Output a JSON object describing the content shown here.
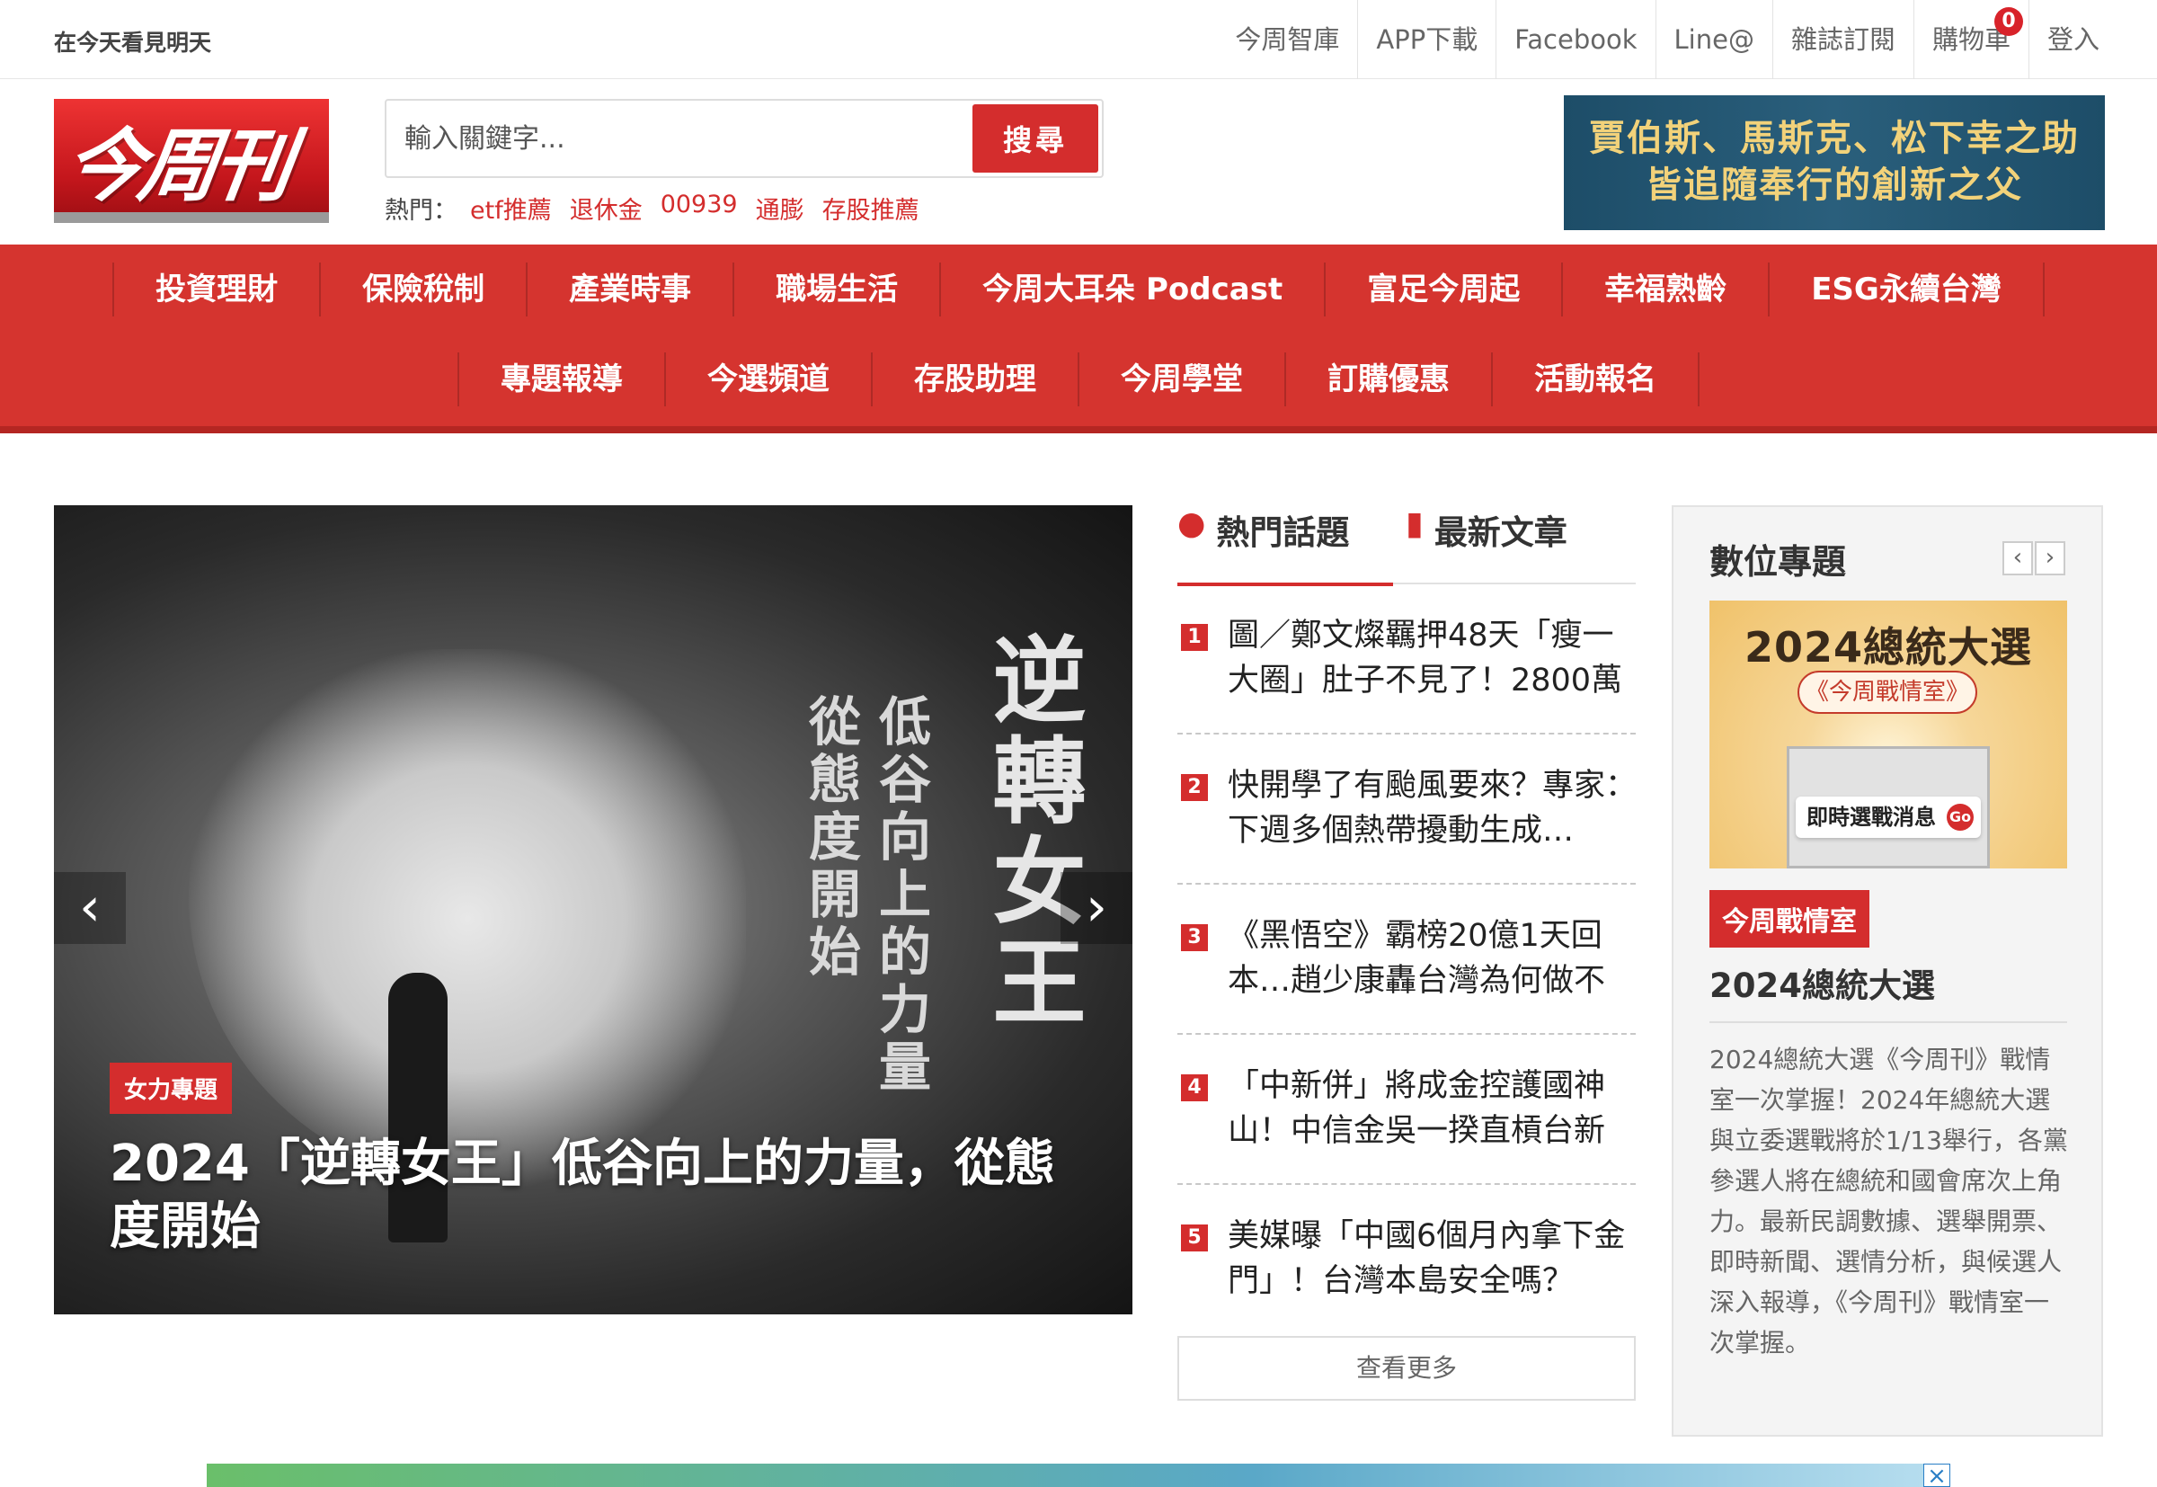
{
  "topbar": {
    "slogan": "在今天看見明天",
    "links": [
      "今周智庫",
      "APP下載",
      "Facebook",
      "Line@",
      "雜誌訂閱",
      "購物車",
      "登入"
    ],
    "cart_count": "0"
  },
  "header": {
    "logo_text": "今周刊",
    "search_placeholder": "輸入關鍵字...",
    "search_button": "搜尋",
    "hot_label": "熱門：",
    "hot_keywords": [
      "etf推薦",
      "退休金",
      "00939",
      "通膨",
      "存股推薦"
    ],
    "banner_line1": "賈伯斯、馬斯克、松下幸之助",
    "banner_line2": "皆追隨奉行的創新之父"
  },
  "nav": {
    "row1": [
      "投資理財",
      "保險稅制",
      "產業時事",
      "職場生活",
      "今周大耳朵 Podcast",
      "富足今周起",
      "幸福熟齡",
      "ESG永續台灣"
    ],
    "row2": [
      "專題報導",
      "今選頻道",
      "存股助理",
      "今周學堂",
      "訂購優惠",
      "活動報名"
    ]
  },
  "hero": {
    "tag": "女力專題",
    "title": "2024「逆轉女王」低谷向上的力量，從態度開始",
    "vertical_big": "逆轉女王",
    "vertical_line1": "低谷向上的力量",
    "vertical_line2": "從態度開始"
  },
  "hot_topics": {
    "tab_hot": "熱門話題",
    "tab_new": "最新文章",
    "articles": [
      {
        "num": "1",
        "title": "圖／鄭文燦羈押48天「瘦一大圈」肚子不見了！2800萬"
      },
      {
        "num": "2",
        "title": "快開學了有颱風要來？專家：下週多個熱帶擾動生成…"
      },
      {
        "num": "3",
        "title": "《黑悟空》霸榜20億1天回本…趙少康轟台灣為何做不"
      },
      {
        "num": "4",
        "title": "「中新併」將成金控護國神山！中信金吳一揆直槓台新"
      },
      {
        "num": "5",
        "title": "美媒曝「中國6個月內拿下金門」！台灣本島安全嗎？"
      }
    ],
    "more": "查看更多"
  },
  "digital": {
    "title": "數位專題",
    "img_title": "2024總統大選",
    "img_sub": "《今周戰情室》",
    "img_label": "即時選戰消息",
    "img_go": "Go",
    "tag": "今周戰情室",
    "headline": "2024總統大選",
    "desc": "2024總統大選《今周刊》戰情室一次掌握！2024年總統大選與立委選戰將於1/13舉行，各黨參選人將在總統和國會席次上角力。最新民調數據、選舉開票、即時新聞、選情分析，與候選人深入報導，《今周刊》戰情室一次掌握。"
  },
  "ad": {
    "close": "×"
  }
}
